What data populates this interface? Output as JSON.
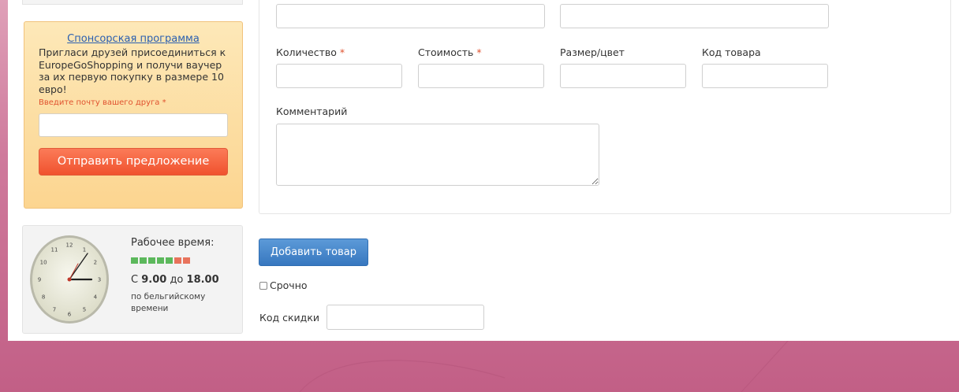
{
  "sponsor": {
    "title": "Спонсорская программа",
    "text": "Пригласи друзей присоединиться к EuropeGoShopping и получи ваучер за их первую покупку в размере 10 евро!",
    "email_label": "Введите почту вашего друга",
    "required_mark": "*",
    "email_value": "",
    "send_button": "Отправить предложение"
  },
  "working_hours": {
    "title": "Рабочее время:",
    "prefix": "С",
    "from": "9.00",
    "to_word": "до",
    "to": "18.00",
    "zone": "по бельгийскому времени",
    "day_squares": [
      "#5cb85c",
      "#5cb85c",
      "#5cb85c",
      "#5cb85c",
      "#5cb85c",
      "#e8735c",
      "#e8735c"
    ],
    "clock_numbers": [
      "12",
      "1",
      "2",
      "3",
      "4",
      "5",
      "6",
      "7",
      "8",
      "9",
      "10",
      "11"
    ]
  },
  "form": {
    "top_field_1_value": "",
    "top_field_2_value": "",
    "quantity_label": "Количество",
    "cost_label": "Стоимость",
    "size_color_label": "Размер/цвет",
    "product_code_label": "Код товара",
    "required_mark": "*",
    "quantity_value": "",
    "cost_value": "",
    "size_color_value": "",
    "product_code_value": "",
    "comment_label": "Комментарий",
    "comment_value": "",
    "add_button": "Добавить товар",
    "urgent_label": "Срочно",
    "urgent_checked": false,
    "discount_label": "Код скидки",
    "discount_value": ""
  },
  "colors": {
    "accent_orange": "#f0522e",
    "accent_blue": "#3777bf",
    "background_pink": "#c9688c"
  }
}
